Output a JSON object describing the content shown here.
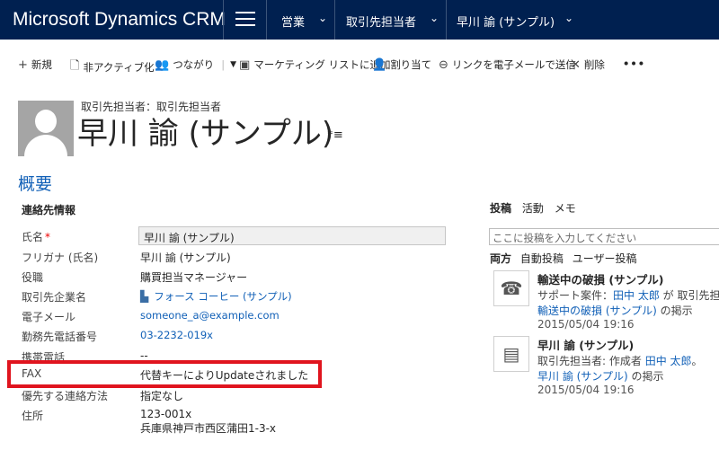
{
  "nav": {
    "brand": "Microsoft Dynamics CRM",
    "items": [
      "営業",
      "取引先担当者",
      "早川 諭 (サンプル)"
    ],
    "chevron": "⌄"
  },
  "commands": [
    {
      "icon": "plus-icon",
      "glyph": "+",
      "label": "新規"
    },
    {
      "icon": "deactivate-icon",
      "glyph": "🗋",
      "label": "非アクティブ化"
    },
    {
      "icon": "connection-icon",
      "glyph": "👥",
      "label": "つながり"
    },
    {
      "icon": "marketing-list-icon",
      "glyph": "▣",
      "label": "マーケティング リストに追加"
    },
    {
      "icon": "assign-icon",
      "glyph": "👤",
      "label": "割り当て"
    },
    {
      "icon": "email-link-icon",
      "glyph": "⊖",
      "label": "リンクを電子メールで送信"
    },
    {
      "icon": "delete-icon",
      "glyph": "✕",
      "label": "削除"
    },
    {
      "icon": "more-icon",
      "glyph": "•••",
      "label": ""
    }
  ],
  "header": {
    "record_type": "取引先担当者：取引先担当者",
    "name": "早川 諭 (サンプル)",
    "menu_glyph": "⁼≡"
  },
  "section": {
    "title": "概要",
    "subheading": "連絡先情報"
  },
  "fields": {
    "name": {
      "label": "氏名",
      "required": "*",
      "value": "早川 諭 (サンプル)"
    },
    "furigana": {
      "label": "フリガナ (氏名)",
      "value": "早川 諭 (サンプル)"
    },
    "jobtitle": {
      "label": "役職",
      "value": "購買担当マネージャー"
    },
    "account": {
      "label": "取引先企業名",
      "value": "フォース コーヒー (サンプル)"
    },
    "email": {
      "label": "電子メール",
      "value": "someone_a@example.com"
    },
    "phone": {
      "label": "勤務先電話番号",
      "value": "03-2232-019x"
    },
    "mobile": {
      "label": "携帯電話",
      "value": "--"
    },
    "fax": {
      "label": "FAX",
      "value": "代替キーによりUpdateされました"
    },
    "preferred": {
      "label": "優先する連絡方法",
      "value": "指定なし"
    },
    "address": {
      "label": "住所",
      "line1": "123-001x",
      "line2": "兵庫県神戸市西区蒲田1-3-x"
    }
  },
  "social": {
    "tabs": [
      "投稿",
      "活動",
      "メモ"
    ],
    "post_placeholder": "ここに投稿を入力してください",
    "filters": [
      "両方",
      "自動投稿",
      "ユーザー投稿"
    ],
    "posts": [
      {
        "icon": "phone-case-icon",
        "title": "輸送中の破損 (サンプル)",
        "line1_prefix": "サポート案件：",
        "line1_link": "田中 太郎",
        "line1_suffix": " が 取引先担当者",
        "line2_link": "輸送中の破損 (サンプル)",
        "line2_suffix": " の掲示",
        "timestamp": "2015/05/04 19:16"
      },
      {
        "icon": "contact-card-icon",
        "title": "早川 諭 (サンプル)",
        "line1_prefix": "取引先担当者: 作成者 ",
        "line1_link": "田中 太郎",
        "line1_suffix": "。",
        "line2_link": "早川 諭 (サンプル)",
        "line2_suffix": " の掲示",
        "timestamp": "2015/05/04 19:16"
      }
    ]
  },
  "colors": {
    "nav_bg": "#002050",
    "accent": "#1160b7",
    "highlight_border": "#e0141e"
  }
}
